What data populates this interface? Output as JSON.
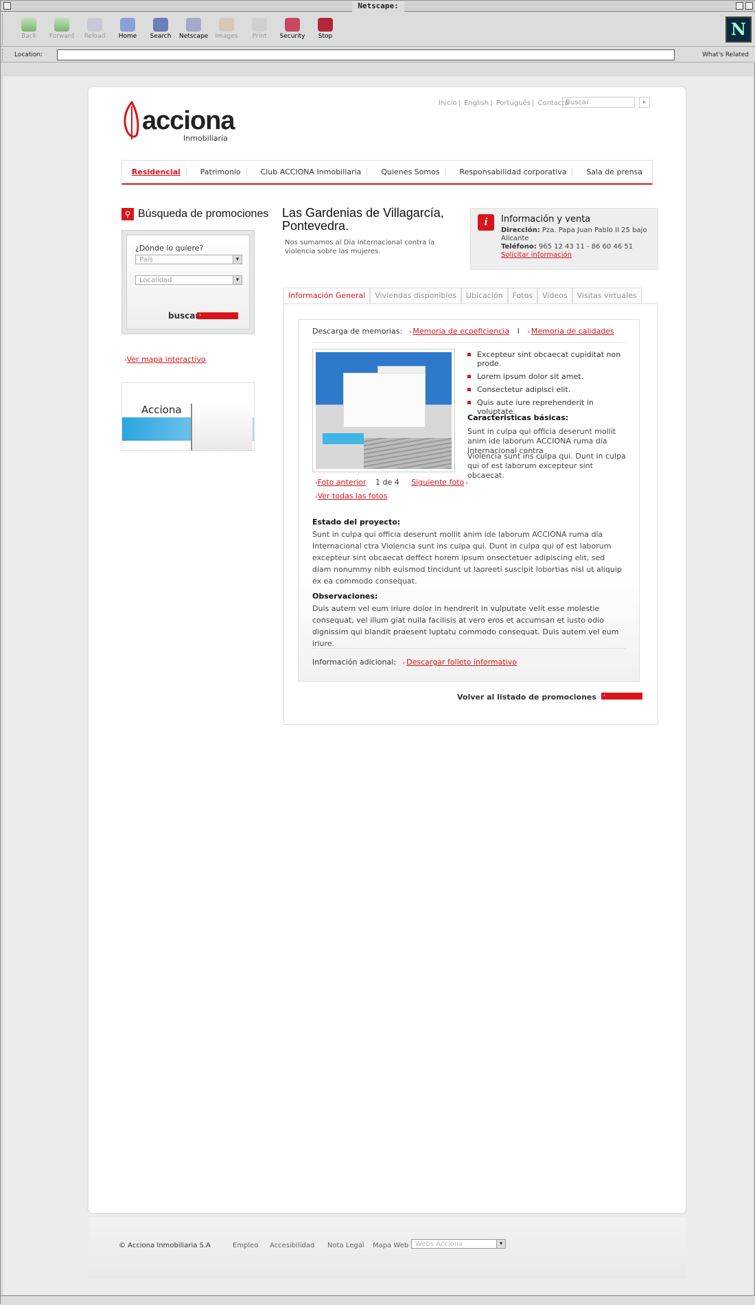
{
  "browser": {
    "title": "Netscape:",
    "toolbar": [
      {
        "label": "Back",
        "icon": "back-arrow-icon",
        "enabled": false
      },
      {
        "label": "Forward",
        "icon": "forward-arrow-icon",
        "enabled": false
      },
      {
        "label": "Reload",
        "icon": "reload-icon",
        "enabled": false
      },
      {
        "label": "Home",
        "icon": "home-icon",
        "enabled": true
      },
      {
        "label": "Search",
        "icon": "search-icon",
        "enabled": true
      },
      {
        "label": "Netscape",
        "icon": "netscape-icon",
        "enabled": true
      },
      {
        "label": "Images",
        "icon": "images-icon",
        "enabled": false
      },
      {
        "label": "Print",
        "icon": "print-icon",
        "enabled": false
      },
      {
        "label": "Security",
        "icon": "lock-icon",
        "enabled": true
      },
      {
        "label": "Stop",
        "icon": "stop-icon",
        "enabled": true
      }
    ],
    "location_label": "Location:",
    "location_value": "",
    "whats_related": "What's Related",
    "brand_letter": "N"
  },
  "site": {
    "logo_text": "acciona",
    "logo_sub": "Inmobiliaria",
    "brand_color": "#d8131a",
    "top_links": [
      "Inicio",
      "English",
      "Português",
      "Contacto"
    ],
    "search_placeholder": "Buscar",
    "nav": [
      "Residencial",
      "Patrimonio",
      "Club ACCIONA Inmobiliaria",
      "Quienes Somos",
      "Responsabilidad corporativa",
      "Sala de prensa"
    ],
    "nav_active": "Residencial"
  },
  "left": {
    "heading": "Búsqueda de promociones",
    "question": "¿Dónde lo quiere?",
    "pais": "País",
    "localidad": "Localidad",
    "buscar": "buscar",
    "mapa_link": "Ver mapa interactivo",
    "banner_text": "Acciona"
  },
  "promo": {
    "title": "Las Gardenias de Villagarcía, Pontevedra.",
    "subtitle": "Nos sumamos al Día Internacional contra la violencia sobre las mujeres."
  },
  "info": {
    "title": "Información y venta",
    "direccion_label": "Dirección:",
    "direccion": "Pza. Papa Juan Pablo II 25 bajo Alicante",
    "telefono_label": "Teléfono:",
    "telefono": "965 12 43 11 - 86 60 46 51",
    "solicitar": "Solicitar información"
  },
  "tabs": [
    "Información General",
    "Viviendas disponibles",
    "Ubicación",
    "Fotos",
    "Videos",
    "Visitas virtuales"
  ],
  "tab_active": "Información General",
  "content": {
    "descarga_label": "Descarga de memorias:",
    "memoria1": "Memoria de ecoeficiencia",
    "sep": "I",
    "memoria2": "Memoria de calidades",
    "bullets": [
      "Excepteur sint obcaecat cupiditat non prode.",
      "Lorem ipsum dolor sit amet.",
      "Consectetur adipisci elit.",
      "Quis aute iure reprehenderit in voluptate."
    ],
    "caract_title": "Caracteristicas básicas:",
    "caract_p1": "Sunt in culpa qui officia deserunt mollit anim ide laborum ACCIONA ruma día Internacional contra",
    "caract_p2": "Violencia sunt ins culpa qui. Dunt in culpa qui of est laborum excepteur sint obcaecat.",
    "foto_anterior": "Foto anterior",
    "foto_count": "1 de 4",
    "foto_siguiente": "Siguiente foto",
    "ver_todas": "Ver todas las fotos",
    "estado_title": "Estado del proyecto:",
    "estado_text": "Sunt in culpa qui officia deserunt mollit anim ide laborum ACCIONA ruma día Internacional ctra Violencia sunt ins culpa qui. Dunt in culpa qui of est laborum excepteur sint obcaecat deffect horem ipsum onsectetuer adipiscing elit, sed diam nonummy nibh euismod tincidunt ut laoreeti suscipit lobortias nisl ut aliquip ex ea commodo consequat.",
    "obs_title": "Observaciones:",
    "obs_text": "Duis autem vel eum iriure dolor in hendrerit in vulputate velit esse molestie consequat, vel illum giat nulla facilisis at vero eros et accumsan et iusto odio dignissim qui blandit praesent luptatu commodo consequat. Duis autem vel eum iriure.",
    "adicional_label": "Información adicional:",
    "folleto": "Descargar folleto informativo",
    "volver": "Volver al listado de promociones"
  },
  "footer": {
    "copyright": "© Acciona Inmobiliaria S.A",
    "links": [
      "Empleo",
      "Accesibilidad",
      "Nota Legal",
      "Mapa Web"
    ],
    "webs_select": "Webs Acciona"
  }
}
